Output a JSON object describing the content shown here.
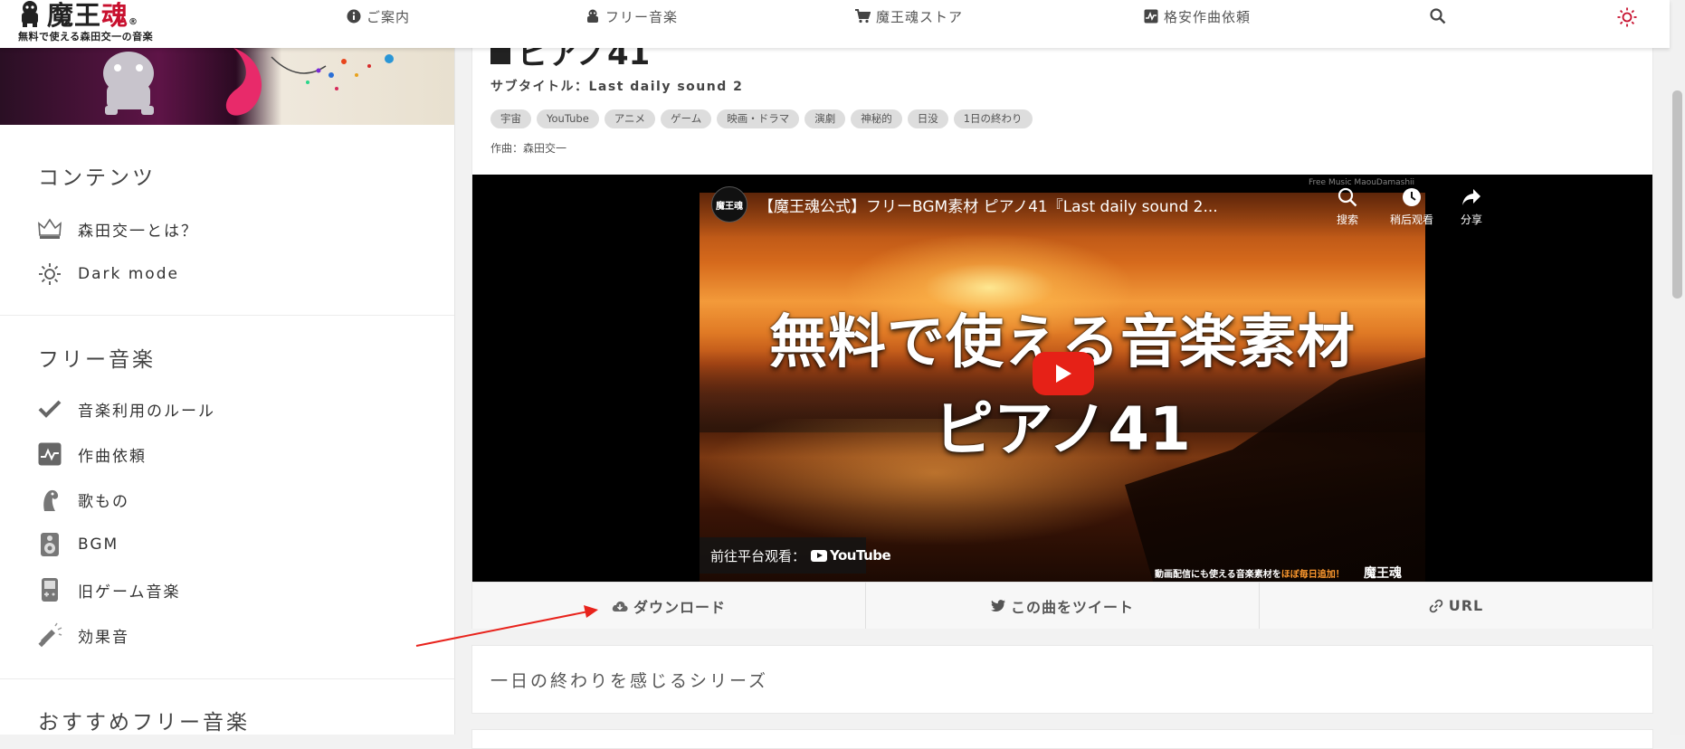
{
  "logo": {
    "title_black": "魔王",
    "title_red": "魂",
    "reg": "®",
    "subtitle": "無料で使える森田交一の音楽"
  },
  "nav": {
    "items": [
      {
        "label": "ご案内",
        "icon": "info-icon"
      },
      {
        "label": "フリー音楽",
        "icon": "robot-icon"
      },
      {
        "label": "魔王魂ストア",
        "icon": "cart-icon"
      },
      {
        "label": "格安作曲依頼",
        "icon": "waveform-icon"
      }
    ],
    "search_icon": "search-icon",
    "theme_icon": "sun-icon",
    "theme_color": "#c8102e"
  },
  "sidebar": {
    "sections": [
      {
        "title": "コンテンツ",
        "items": [
          {
            "label": "森田交一とは？",
            "icon": "crown-icon"
          },
          {
            "label": "Dark mode",
            "icon": "sun-icon"
          }
        ]
      },
      {
        "title": "フリー音楽",
        "items": [
          {
            "label": "音楽利用のルール",
            "icon": "check-icon"
          },
          {
            "label": "作曲依頼",
            "icon": "waveform-icon"
          },
          {
            "label": "歌もの",
            "icon": "singer-icon"
          },
          {
            "label": "BGM",
            "icon": "speaker-icon"
          },
          {
            "label": "旧ゲーム音楽",
            "icon": "gameboy-icon"
          },
          {
            "label": "効果音",
            "icon": "megaphone-icon"
          }
        ]
      },
      {
        "title": "おすすめフリー音楽",
        "items": []
      }
    ]
  },
  "song": {
    "title_partial": "ピアノ41",
    "subtitle": "サブタイトル：Last daily sound 2",
    "tags": [
      "宇宙",
      "YouTube",
      "アニメ",
      "ゲーム",
      "映画・ドラマ",
      "演劇",
      "神秘的",
      "日没",
      "1日の終わり"
    ],
    "composer": "作曲：森田交一"
  },
  "video": {
    "channel_logo_text": "魔王魂",
    "title": "【魔王魂公式】フリーBGM素材 ピアノ41『Last daily sound 2...",
    "actions": [
      {
        "label": "搜索",
        "icon": "search-icon"
      },
      {
        "label": "稍后观看",
        "icon": "clock-icon"
      },
      {
        "label": "分享",
        "icon": "share-icon"
      }
    ],
    "watermark": "Free Music MaouDamashii",
    "thumb_line1": "無料で使える音楽素材",
    "thumb_line2": "ピアノ41",
    "watch_on": "前往平台观看：",
    "youtube_word": "YouTube",
    "promo_a": "動画配信にも使える音楽素材を",
    "promo_b": "ほぼ毎日追加！",
    "promo_brand": "魔王魂"
  },
  "actions": [
    {
      "label": "ダウンロード",
      "icon": "cloud-download-icon"
    },
    {
      "label": "この曲をツイート",
      "icon": "twitter-icon"
    },
    {
      "label": "URL",
      "icon": "link-icon"
    }
  ],
  "series": {
    "label": "一日の終わりを感じるシリーズ"
  },
  "annotation": {
    "arrow_color": "#e8231c"
  }
}
